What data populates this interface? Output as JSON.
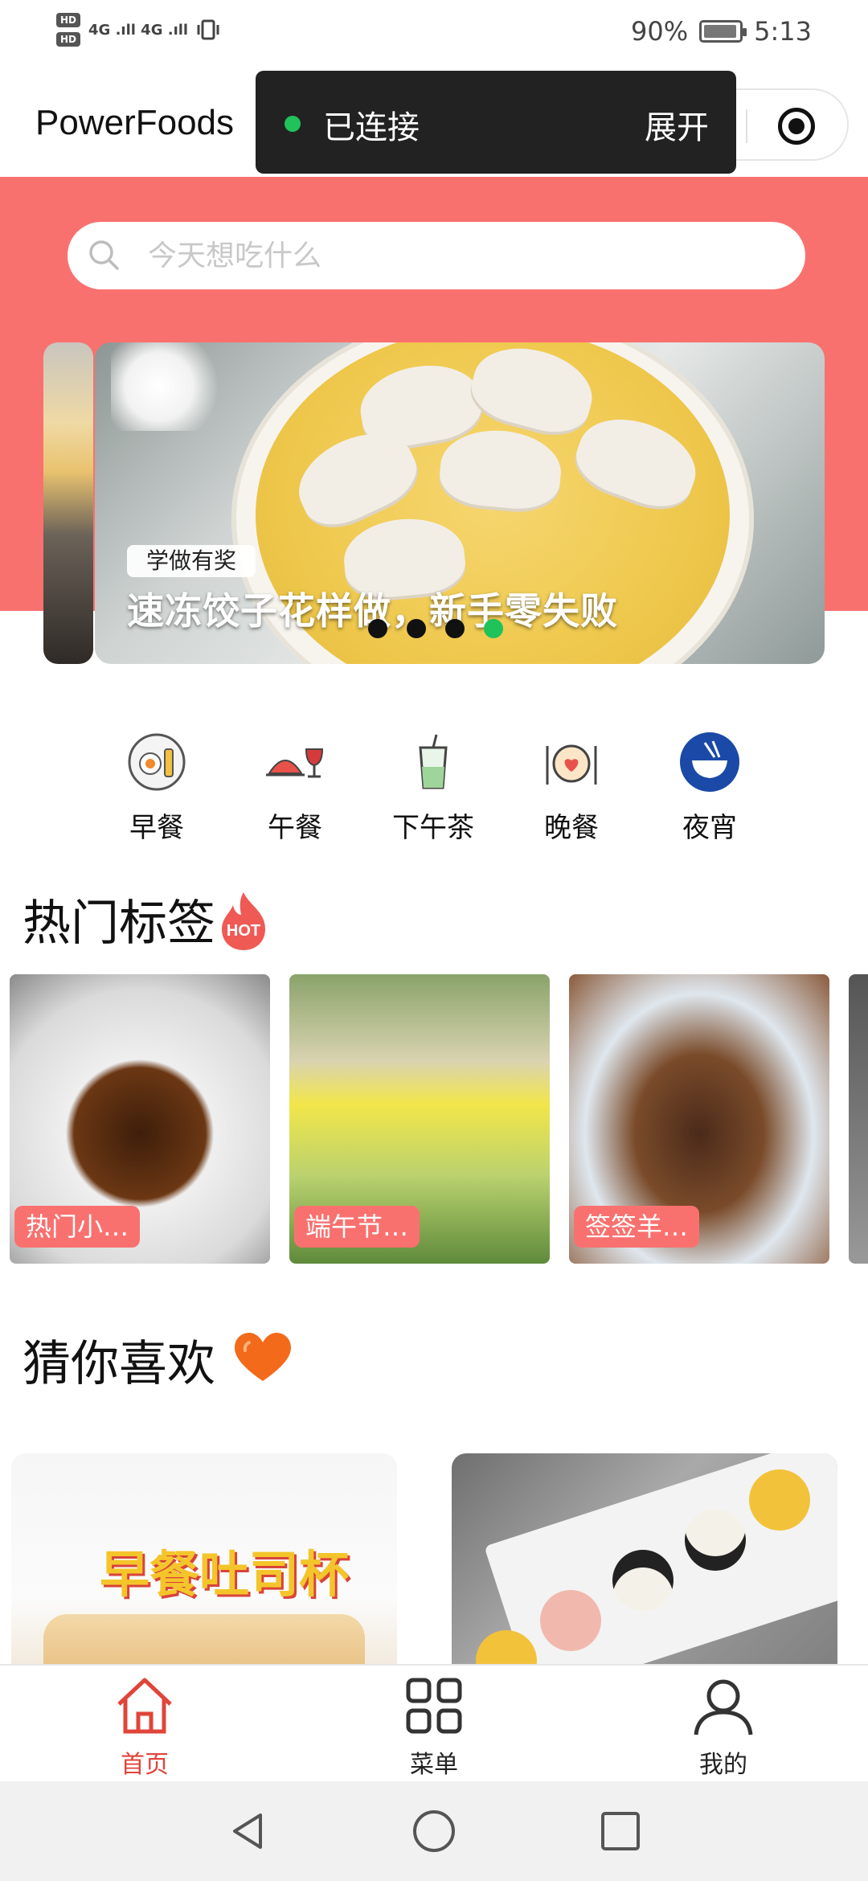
{
  "status_bar": {
    "hd1": "HD",
    "hd2": "HD",
    "signal": "4G .ıll 4G .ıll",
    "battery": "90%",
    "time": "5:13"
  },
  "header": {
    "title": "PowerFoods"
  },
  "connection": {
    "status": "已连接",
    "expand": "展开",
    "dot_color": "#1fc35a"
  },
  "search": {
    "placeholder": "今天想吃什么"
  },
  "banner": {
    "tag": "学做有奖",
    "title": "速冻饺子花样做，新手零失败",
    "slide_count": 4,
    "active_index": 3
  },
  "categories": [
    {
      "label": "早餐",
      "icon": "breakfast-icon"
    },
    {
      "label": "午餐",
      "icon": "lunch-icon"
    },
    {
      "label": "下午茶",
      "icon": "afternoon-tea-icon"
    },
    {
      "label": "晚餐",
      "icon": "dinner-icon"
    },
    {
      "label": "夜宵",
      "icon": "late-night-snack-icon"
    }
  ],
  "hot_tags": {
    "title": "热门标签",
    "badge": "HOT",
    "items": [
      {
        "label": "热门小…"
      },
      {
        "label": "端午节…"
      },
      {
        "label": "签签羊…"
      }
    ]
  },
  "recommend": {
    "title": "猜你喜欢",
    "card1_text": "早餐吐司杯"
  },
  "tab_bar": {
    "items": [
      {
        "label": "首页",
        "icon": "home-icon",
        "active": true
      },
      {
        "label": "菜单",
        "icon": "menu-grid-icon",
        "active": false
      },
      {
        "label": "我的",
        "icon": "profile-icon",
        "active": false
      }
    ]
  },
  "colors": {
    "brand": "#f9716f",
    "active_tab": "#e0443a",
    "online": "#1fc35a"
  }
}
